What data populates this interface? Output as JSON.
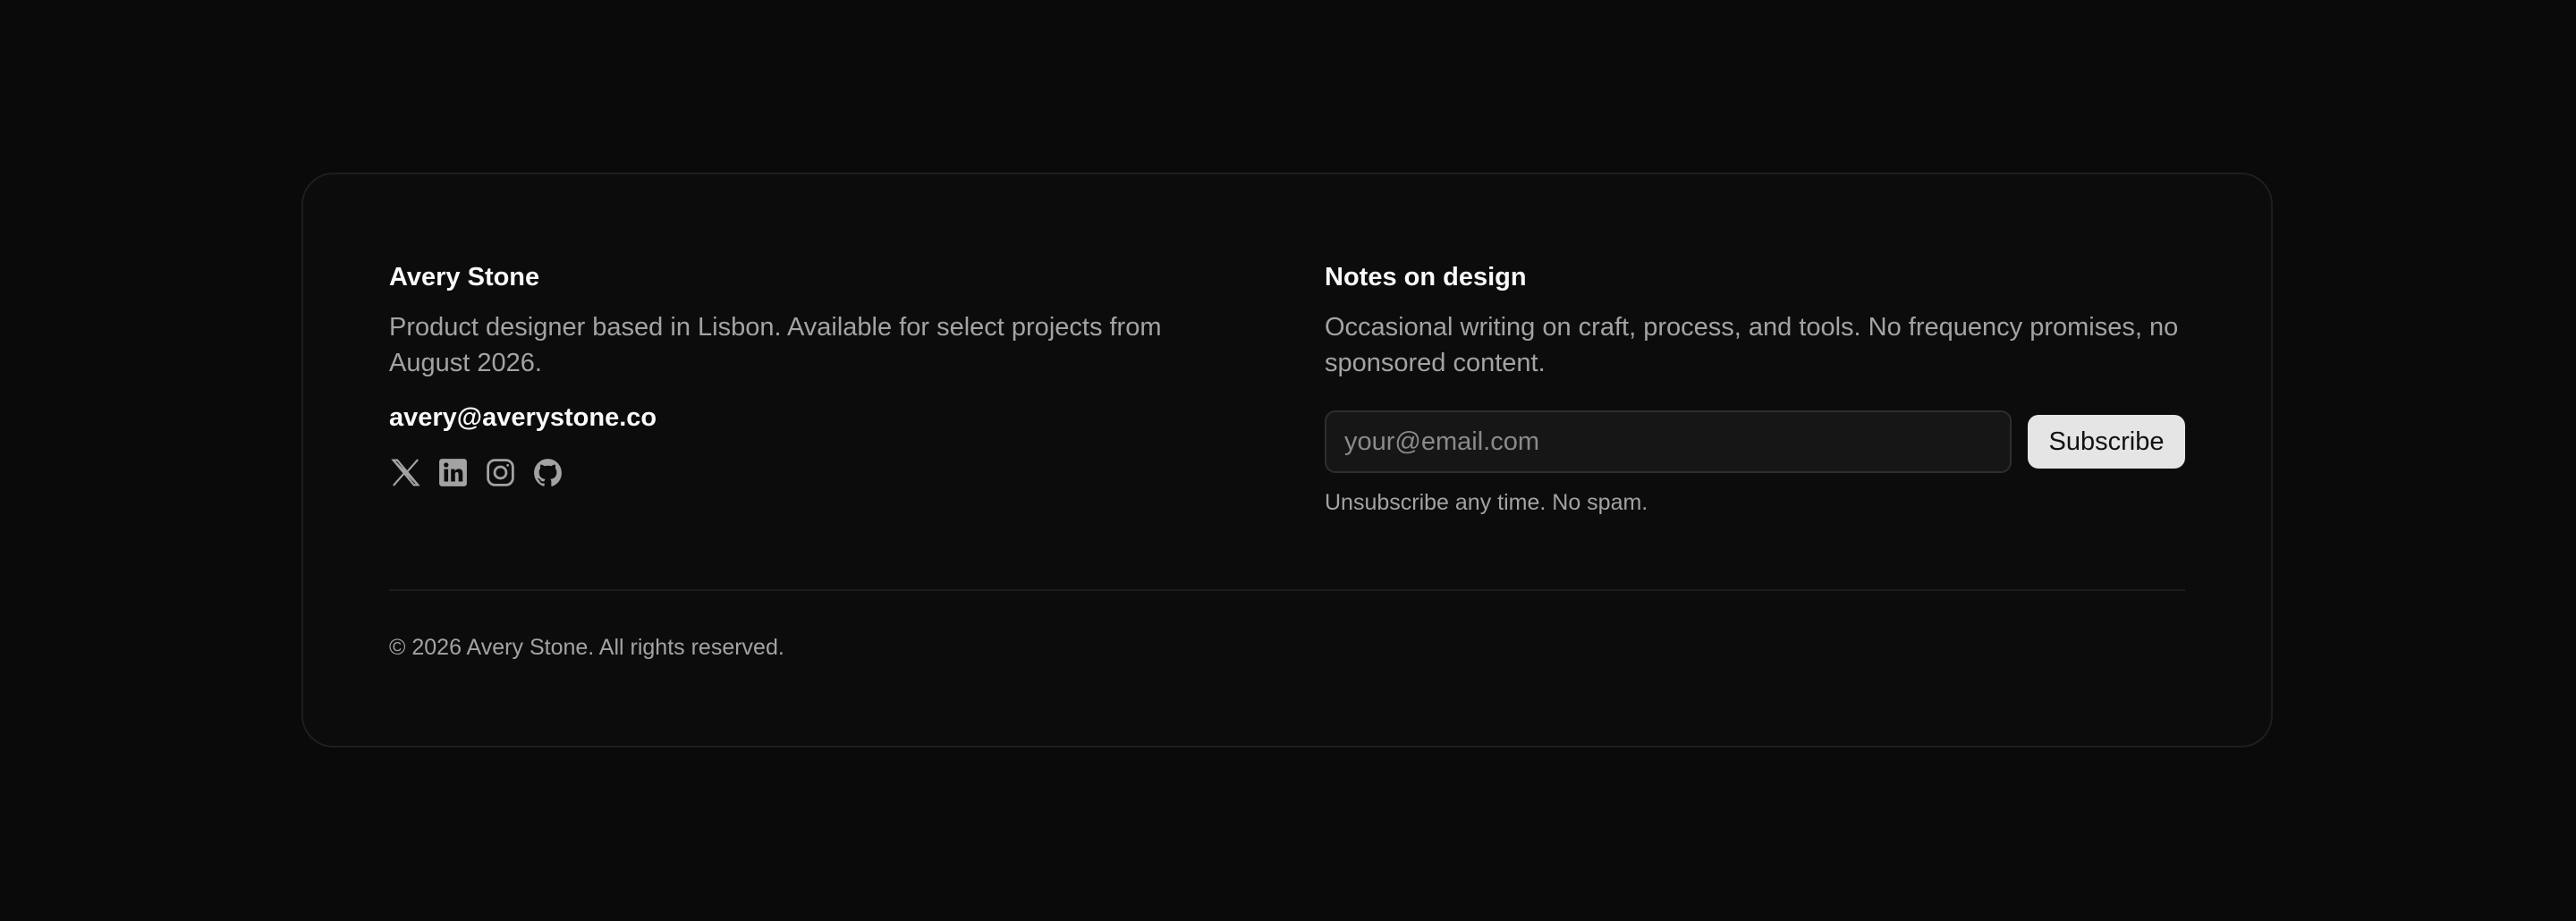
{
  "profile": {
    "name": "Avery Stone",
    "bio": "Product designer based in Lisbon. Available for select projects from August 2026.",
    "email": "avery@averystone.co",
    "socials": [
      {
        "icon": "x-icon",
        "label": "X"
      },
      {
        "icon": "linkedin-icon",
        "label": "LinkedIn"
      },
      {
        "icon": "instagram-icon",
        "label": "Instagram"
      },
      {
        "icon": "github-icon",
        "label": "GitHub"
      }
    ]
  },
  "newsletter": {
    "title": "Notes on design",
    "description": "Occasional writing on craft, process, and tools. No frequency promises, no sponsored content.",
    "input_placeholder": "your@email.com",
    "input_value": "",
    "button_label": "Subscribe",
    "note": "Unsubscribe any time. No spam."
  },
  "footer": {
    "copyright": "© 2026 Avery Stone. All rights reserved."
  },
  "colors": {
    "background": "#0a0a0a",
    "card": "#0c0c0c",
    "text_primary": "#fafafa",
    "text_muted": "#a3a3a3",
    "button_bg": "#e5e5e5"
  }
}
